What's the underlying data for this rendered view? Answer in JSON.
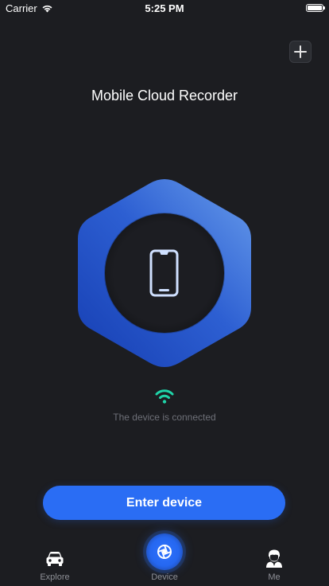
{
  "status_bar": {
    "carrier": "Carrier",
    "time": "5:25 PM"
  },
  "header": {
    "title": "Mobile Cloud Recorder",
    "add_icon": "plus-icon"
  },
  "main": {
    "device_icon": "smartphone-icon",
    "connection_icon": "wifi-icon",
    "connection_status": "The device is connected",
    "enter_button_label": "Enter device"
  },
  "tab_bar": {
    "tabs": [
      {
        "label": "Explore",
        "icon": "car-icon"
      },
      {
        "label": "Device",
        "icon": "aperture-icon",
        "active": true
      },
      {
        "label": "Me",
        "icon": "user-icon"
      }
    ]
  },
  "colors": {
    "background": "#1c1d21",
    "accent": "#2a6df4",
    "connected": "#1fd3a8",
    "muted_text": "#6e7078"
  }
}
